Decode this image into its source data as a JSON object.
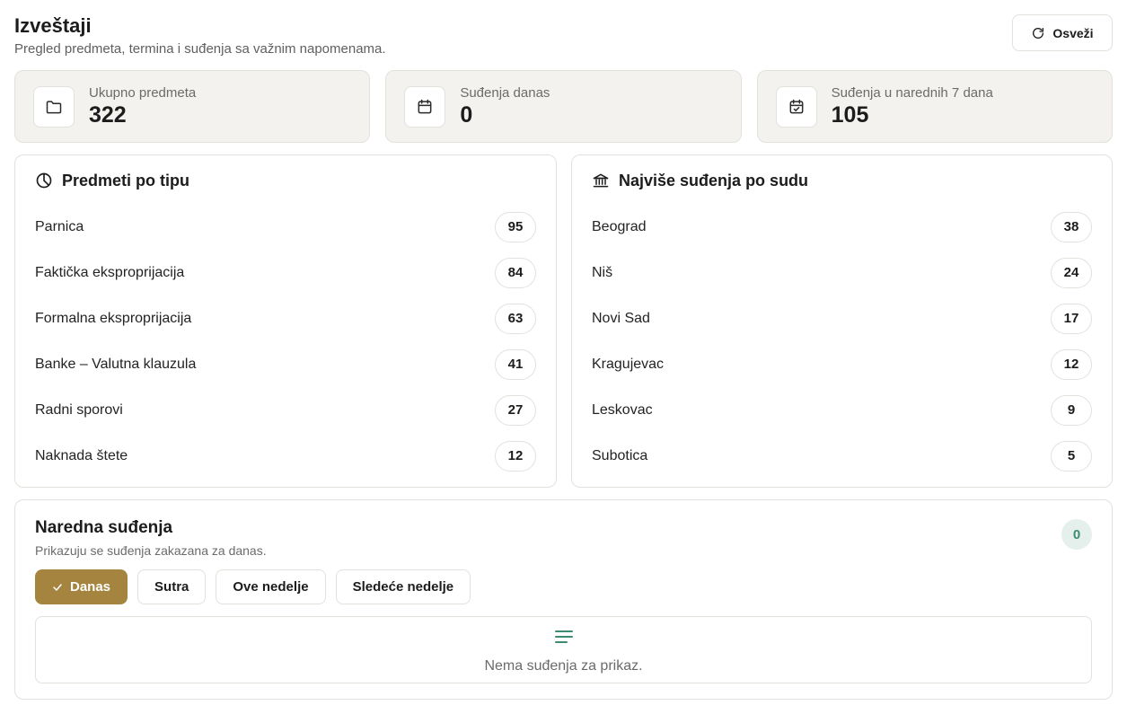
{
  "header": {
    "title": "Izveštaji",
    "subtitle": "Pregled predmeta, termina i suđenja sa važnim napomenama.",
    "refresh_label": "Osveži"
  },
  "stats": [
    {
      "icon": "folder-icon",
      "label": "Ukupno predmeta",
      "value": "322"
    },
    {
      "icon": "calendar-icon",
      "label": "Suđenja danas",
      "value": "0"
    },
    {
      "icon": "calendar-check-icon",
      "label": "Suđenja u narednih 7 dana",
      "value": "105"
    }
  ],
  "by_type": {
    "title": "Predmeti po tipu",
    "icon": "pie-chart-icon",
    "items": [
      {
        "label": "Parnica",
        "count": "95"
      },
      {
        "label": "Faktička eksproprijacija",
        "count": "84"
      },
      {
        "label": "Formalna eksproprijacija",
        "count": "63"
      },
      {
        "label": "Banke – Valutna klauzula",
        "count": "41"
      },
      {
        "label": "Radni sporovi",
        "count": "27"
      },
      {
        "label": "Naknada štete",
        "count": "12"
      }
    ]
  },
  "by_court": {
    "title": "Najviše suđenja po sudu",
    "icon": "courthouse-icon",
    "items": [
      {
        "label": "Beograd",
        "count": "38"
      },
      {
        "label": "Niš",
        "count": "24"
      },
      {
        "label": "Novi Sad",
        "count": "17"
      },
      {
        "label": "Kragujevac",
        "count": "12"
      },
      {
        "label": "Leskovac",
        "count": "9"
      },
      {
        "label": "Subotica",
        "count": "5"
      }
    ]
  },
  "upcoming": {
    "title": "Naredna suđenja",
    "subtitle": "Prikazuju se suđenja zakazana za danas.",
    "count": "0",
    "filters": [
      {
        "label": "Danas",
        "active": true
      },
      {
        "label": "Sutra",
        "active": false
      },
      {
        "label": "Ove nedelje",
        "active": false
      },
      {
        "label": "Sledeće nedelje",
        "active": false
      }
    ],
    "empty_icon": "list-icon",
    "empty_text": "Nema suđenja za prikaz."
  },
  "colors": {
    "accent": "#a4843e",
    "teal": "#3d8a73",
    "card_bg": "#f3f2ee",
    "border": "#e3e1dc"
  }
}
